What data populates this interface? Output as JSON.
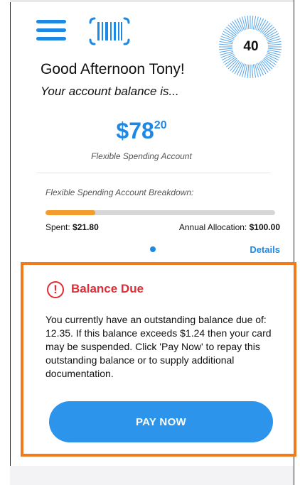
{
  "header": {
    "menu_icon": "hamburger-menu-icon",
    "barcode_icon": "barcode-icon",
    "score": "40"
  },
  "greeting": "Good Afternoon Tony!",
  "balance_intro": "Your account balance is...",
  "balance": {
    "dollars": "$78",
    "cents": "20",
    "account_name": "Flexible Spending Account"
  },
  "breakdown": {
    "label": "Flexible Spending Account Breakdown:",
    "spent_label": "Spent:",
    "spent_value": "$21.80",
    "allocation_label": "Annual Allocation:",
    "allocation_value": "$100.00",
    "spent_fraction": 0.218,
    "details_link": "Details"
  },
  "alert": {
    "icon": "exclamation-circle-icon",
    "icon_glyph": "!",
    "title": "Balance Due",
    "message": "You currently have an outstanding balance due of: 12.35. If this balance exceeds $1.24 then your card may be suspended. Click 'Pay Now' to repay this outstanding balance or to supply additional documentation.",
    "button_label": "PAY NOW"
  },
  "colors": {
    "accent_blue": "#1e88e5",
    "button_blue": "#2d94ec",
    "progress_orange": "#f39c2b",
    "alert_border": "#f07b1c",
    "alert_red": "#e02c35"
  }
}
